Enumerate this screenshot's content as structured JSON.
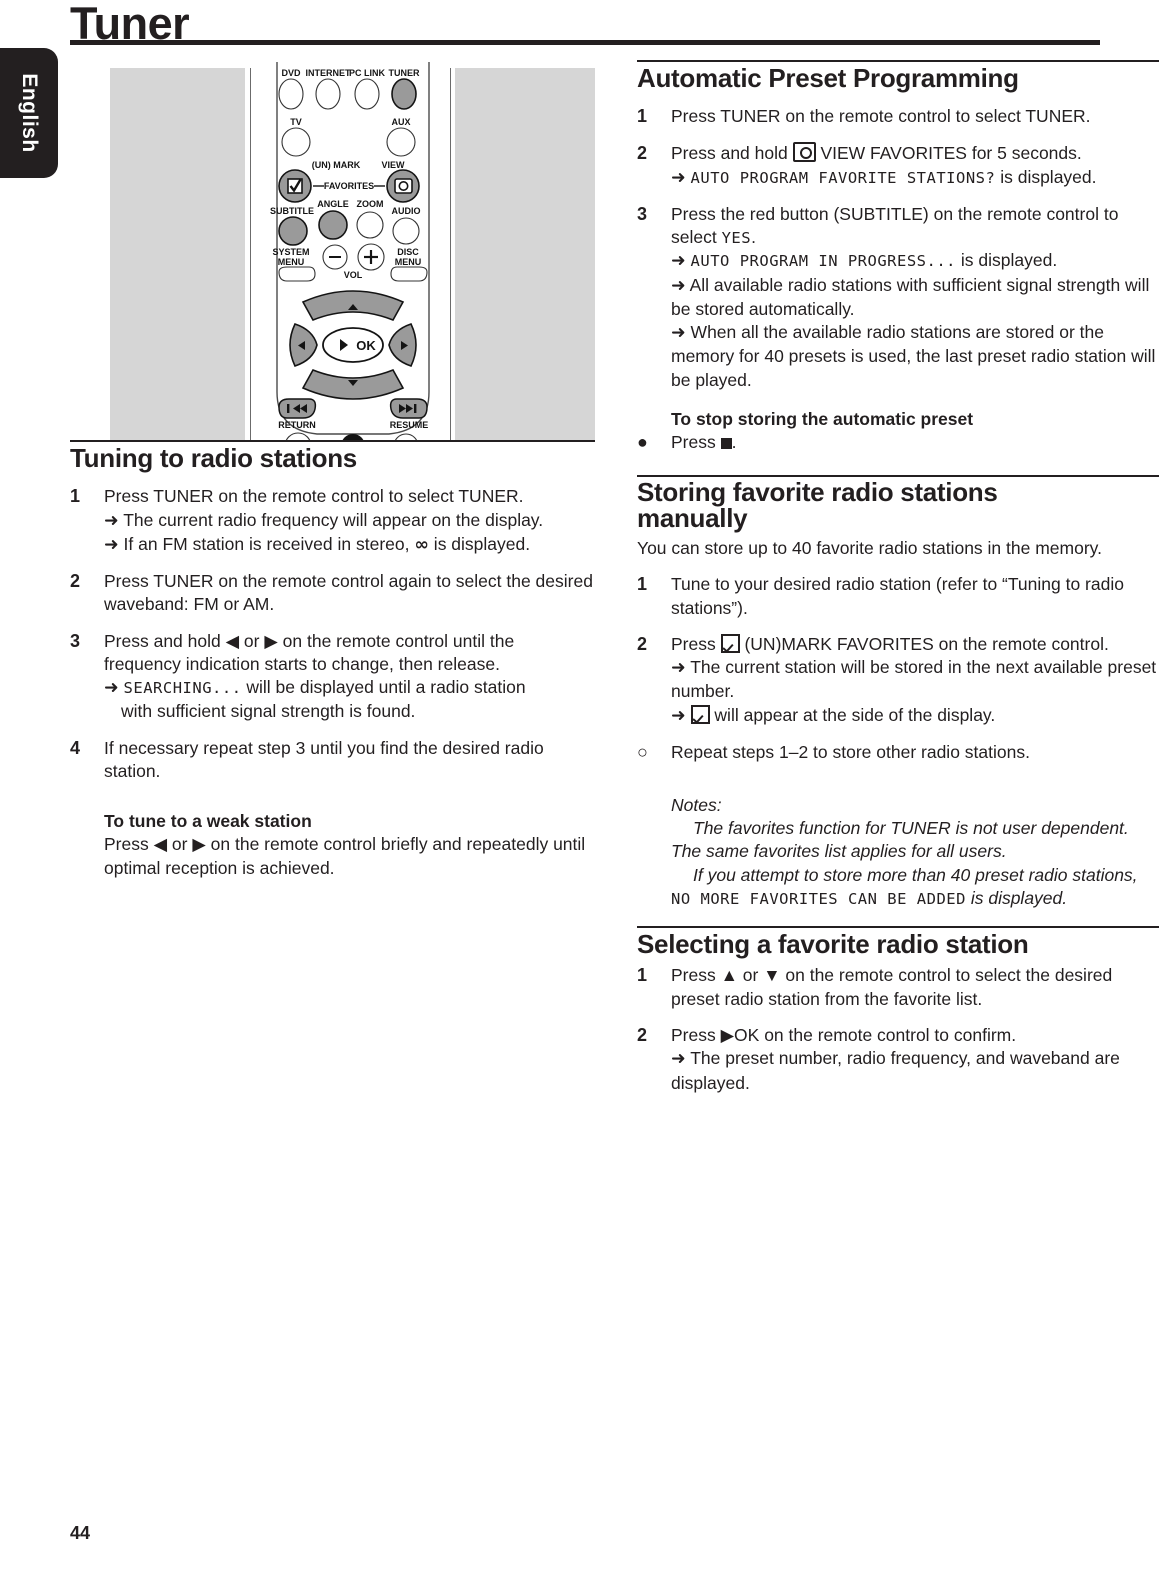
{
  "language_tab": "English",
  "page_title": "Tuner",
  "page_number": "44",
  "remote": {
    "caption_icon": "remote-control-illustration",
    "buttons": [
      {
        "label": "DVD",
        "shape": "ellipse",
        "fill": "white"
      },
      {
        "label": "INTERNET",
        "shape": "ellipse",
        "fill": "white"
      },
      {
        "label": "PC LINK",
        "shape": "ellipse",
        "fill": "white"
      },
      {
        "label": "TUNER",
        "shape": "ellipse",
        "fill": "gray"
      },
      {
        "label": "TV",
        "shape": "circle",
        "fill": "white"
      },
      {
        "label": "AUX",
        "shape": "circle",
        "fill": "white"
      },
      {
        "label": "(UN) MARK",
        "shape": "circle",
        "fill": "gray"
      },
      {
        "label": "VIEW",
        "shape": "circle",
        "fill": "gray"
      },
      {
        "label": "FAVORITES",
        "shape": "text",
        "fill": "none"
      },
      {
        "label": "SUBTITLE",
        "shape": "circle",
        "fill": "gray"
      },
      {
        "label": "ANGLE",
        "shape": "circle",
        "fill": "gray"
      },
      {
        "label": "ZOOM",
        "shape": "circle",
        "fill": "white"
      },
      {
        "label": "AUDIO",
        "shape": "circle",
        "fill": "white"
      },
      {
        "label": "SYSTEM MENU",
        "shape": "tab",
        "fill": "white"
      },
      {
        "label": "DISC MENU",
        "shape": "tab",
        "fill": "white"
      },
      {
        "label": "VOL",
        "shape": "text",
        "fill": "none"
      },
      {
        "label": "OK",
        "shape": "ellipse",
        "fill": "white"
      },
      {
        "label": "RETURN",
        "shape": "tab",
        "fill": "gray"
      },
      {
        "label": "RESUME",
        "shape": "tab",
        "fill": "gray"
      }
    ]
  },
  "left_column": {
    "heading": "Tuning to radio stations",
    "steps": [
      {
        "num": "1",
        "lines": [
          "Press TUNER on the remote control to select TUNER."
        ],
        "subs": [
          "The current radio frequency will appear on the display.",
          "If an FM station is received in stereo, ∞ is displayed."
        ]
      },
      {
        "num": "2",
        "lines": [
          "Press TUNER on the remote control again to select the desired waveband: FM or AM."
        ],
        "subs": []
      },
      {
        "num": "3",
        "lines": [
          "Press and hold ◀ or ▶ on the remote control until the frequency indication starts to change, then release."
        ],
        "subs": [],
        "sub_lcd": {
          "lcd": "SEARCHING...",
          "rest": " will be displayed until a radio station",
          "cont": "with sufficient signal strength is found."
        }
      },
      {
        "num": "4",
        "lines": [
          "If necessary repeat step 3 until you find the desired radio station."
        ],
        "subs": []
      }
    ],
    "weak_station": {
      "subhead": "To tune to a weak station",
      "text": "Press ◀ or ▶ on the remote control briefly and repeatedly until optimal reception is achieved."
    }
  },
  "right_column": {
    "section1": {
      "heading": "Automatic Preset Programming",
      "steps": [
        {
          "num": "1",
          "text": "Press TUNER on the remote control to select TUNER.",
          "subs": []
        },
        {
          "num": "2",
          "text_before_icon": "Press and hold ",
          "icon": "view-favorites-icon",
          "text_after_icon": " VIEW FAVORITES for 5 seconds.",
          "sub_lcd": "AUTO PROGRAM FAVORITE STATIONS?",
          "sub_rest": " is displayed."
        },
        {
          "num": "3",
          "text": "Press the red button (SUBTITLE) on the remote control to select ",
          "lcd_inline": "YES",
          "text_tail": ".",
          "sub_lcd": "AUTO PROGRAM IN PROGRESS...",
          "sub_rest": " is displayed.",
          "subs": [
            "All available radio stations with sufficient signal strength will be stored automatically.",
            "When all the available radio stations are stored or the memory for 40 presets is used, the last preset radio station will be played."
          ]
        }
      ],
      "stop_subhead": "To stop storing the automatic preset",
      "stop_bullet": "●",
      "stop_text_before": "Press ",
      "stop_text_after": "."
    },
    "section2": {
      "heading_line1": "Storing favorite radio stations",
      "heading_line2": "manually",
      "intro": "You can store up to 40 favorite radio stations in the memory.",
      "steps": [
        {
          "num": "1",
          "text": "Tune to your desired radio station (refer to “Tuning to radio stations”)."
        },
        {
          "num": "2",
          "text_before_icon": "Press ",
          "icon": "unmark-favorites-checkbox-icon",
          "text_after_icon": " (UN)MARK FAVORITES on the remote control.",
          "subs": [
            "The current station will be stored in the next available preset number."
          ],
          "sub_icon_text": " will appear at the side of the display."
        },
        {
          "num": "○",
          "text": "Repeat steps 1–2 to store other radio stations."
        }
      ],
      "notes_label": "Notes:",
      "note1": "The favorites function for TUNER is not user dependent. The same favorites list applies for all users.",
      "note2_before": "If you attempt to store more than 40 preset radio stations, ",
      "note2_lcd": "NO MORE FAVORITES CAN BE ADDED",
      "note2_after": " is displayed."
    },
    "section3": {
      "heading": "Selecting a favorite radio station",
      "steps": [
        {
          "num": "1",
          "text": "Press ▲ or ▼ on the remote control to select the desired preset radio station from the favorite list."
        },
        {
          "num": "2",
          "text": "Press ▶OK on the remote control to confirm.",
          "subs": [
            "The preset number, radio frequency, and waveband are displayed."
          ]
        }
      ]
    }
  },
  "colors": {
    "ink": "#231f20",
    "panel_gray": "#d6d6d6",
    "button_gray": "#9a9a9a"
  }
}
